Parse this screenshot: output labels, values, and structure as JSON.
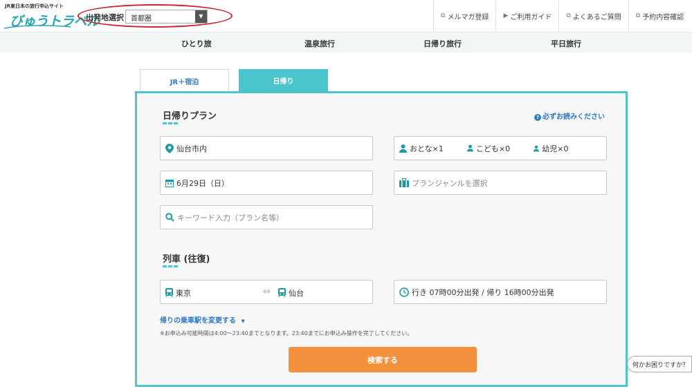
{
  "header": {
    "logo_sub": "JR東日本の旅行申込サイト",
    "logo_main": "びゅうトラベル",
    "departure_label": "出発地選択",
    "departure_value": "首都圏",
    "links": [
      {
        "label": "メルマガ登録",
        "icon": "external-link-icon"
      },
      {
        "label": "ご利用ガイド",
        "icon": "triangle-right-icon"
      },
      {
        "label": "よくあるご質問",
        "icon": "external-link-icon"
      },
      {
        "label": "予約内容確認",
        "icon": "external-link-icon"
      }
    ]
  },
  "categories": [
    "ひとり旅",
    "温泉旅行",
    "日帰り旅行",
    "平日旅行"
  ],
  "tabs": {
    "jr": "JR＋宿泊",
    "day": "日帰り"
  },
  "plan": {
    "title": "日帰りプラン",
    "notice": "必ずお読みください",
    "destination": "仙台市内",
    "adults": "おとな×1",
    "children": "こども×0",
    "infants": "幼児×0",
    "date": "6月29日（日）",
    "genre_placeholder": "プランジャンルを選択",
    "keyword_placeholder": "キーワード入力（プラン名等）"
  },
  "train": {
    "title": "列車 (往復)",
    "from": "東京",
    "to": "仙台",
    "times": "行き 07時00分出発 / 帰り 16時00分出発",
    "return_link": "帰りの乗車駅を変更する",
    "note": "※お申込み可能時間は4:00〜23:40までとなります。23:40までにお申込み操作を完了してください。",
    "search_button": "検索する"
  },
  "help": "何かお困りですか？",
  "colors": {
    "teal": "#4bc4cb",
    "orange": "#f4913e",
    "link_blue": "#2f78c4",
    "highlight_red": "#c8232c"
  }
}
